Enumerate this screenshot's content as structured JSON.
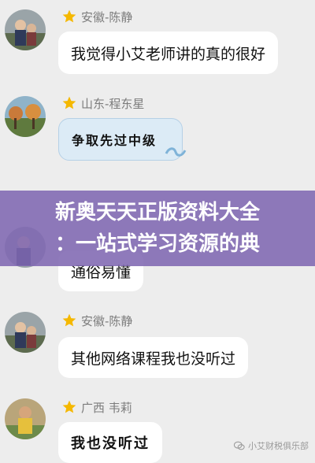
{
  "messages": [
    {
      "sender": "安徽-陈静",
      "text": "我觉得小艾老师讲的真的很好"
    },
    {
      "sender": "山东-程东星",
      "text": "争取先过中级"
    },
    {
      "sender": "",
      "text": "通俗易懂"
    },
    {
      "sender": "安徽-陈静",
      "text": "其他网络课程我也没听过"
    },
    {
      "sender": "广西 韦莉",
      "text": "我也没听过"
    }
  ],
  "banner": {
    "line1": "新奥天天正版资料大全",
    "line2": "：一站式学习资源的典"
  },
  "watermark": {
    "text": "小艾财税俱乐部",
    "icon": "wechat-icon"
  },
  "colors": {
    "background": "#ededed",
    "bubble": "#ffffff",
    "banner": "#8068b2",
    "star": "#f5b800"
  }
}
